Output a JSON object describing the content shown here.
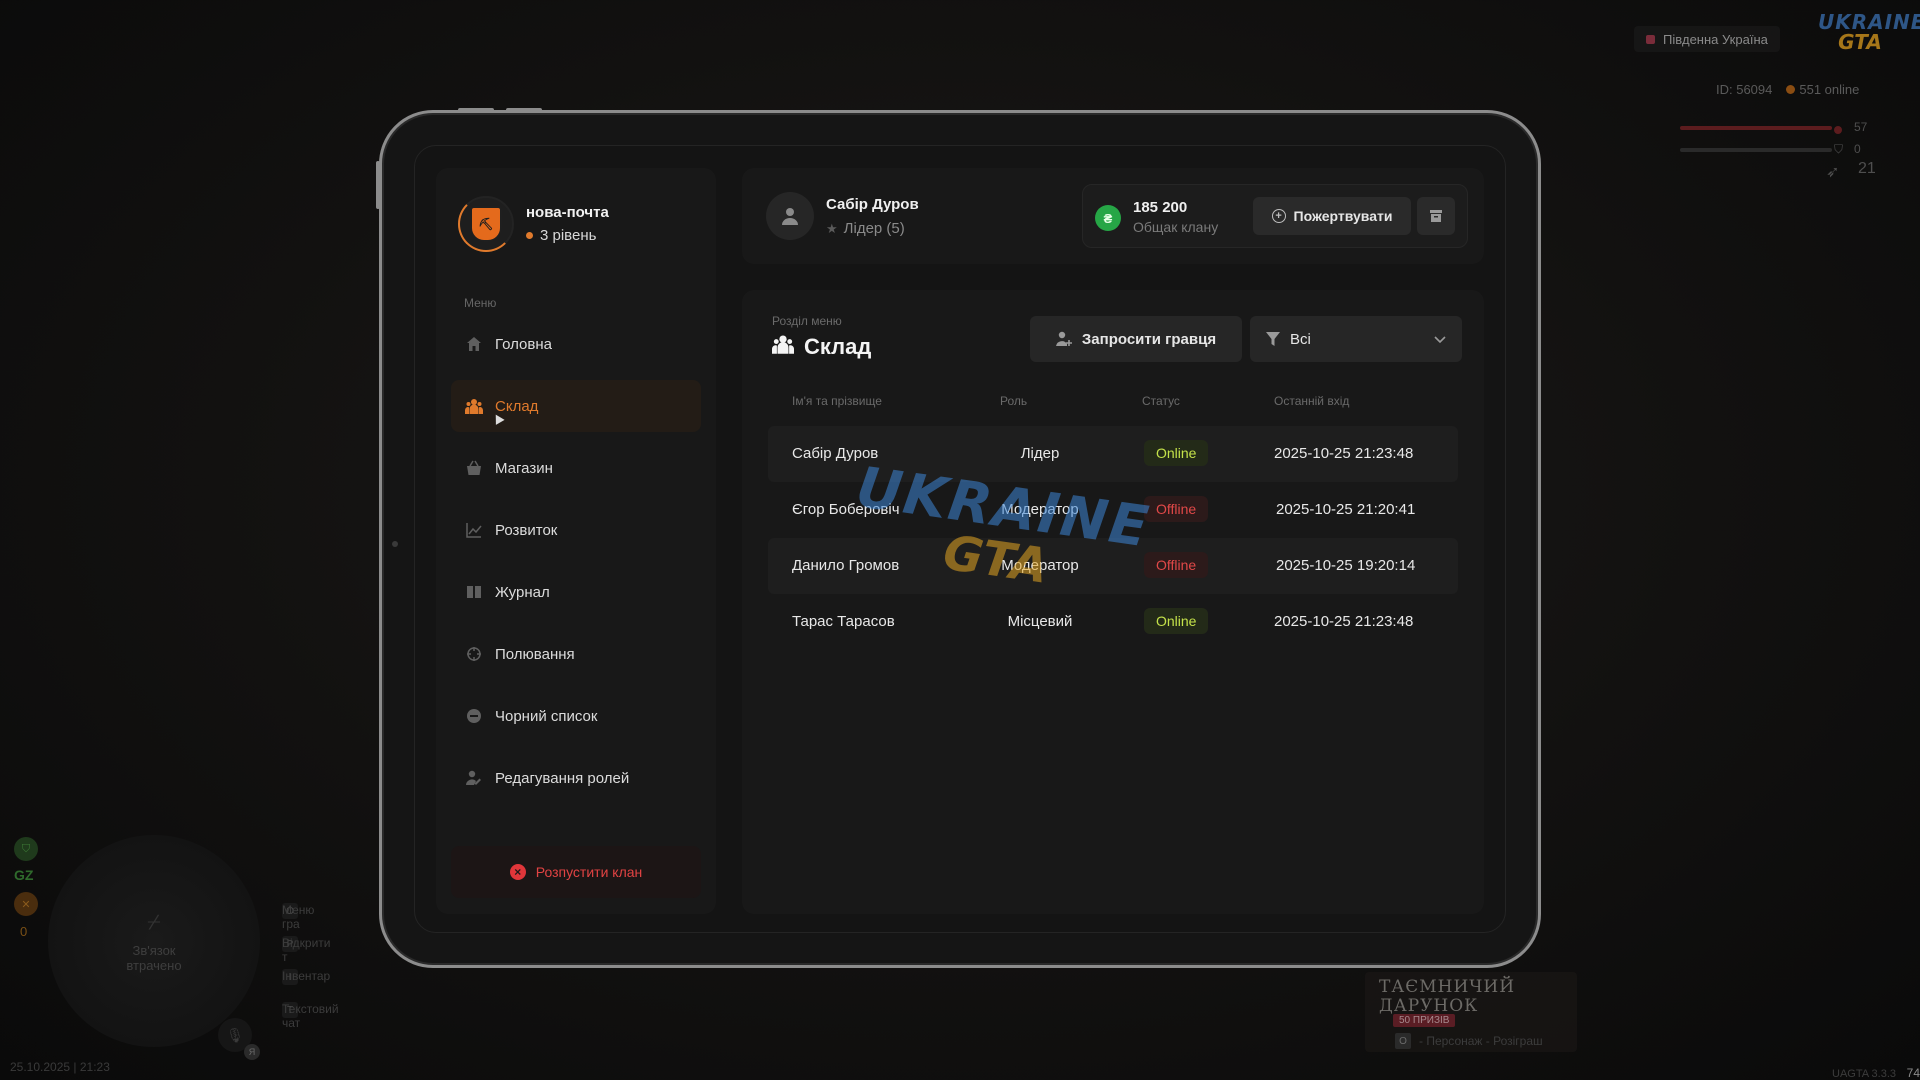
{
  "hud": {
    "server_name": "Південна Україна",
    "logo_line1": "UKRAINE",
    "logo_line2": "GTA",
    "player_id": "ID: 56094",
    "online": "551 online",
    "stat_health": "57",
    "stat_armor": "0",
    "stat_ammo": "21",
    "minimap_status": "Зв'язок втрачено",
    "gz_label": "GZ",
    "counter": "0",
    "keys": [
      {
        "key": "O",
        "label": "Меню гра"
      },
      {
        "key": "P",
        "label": "Відкрити т"
      },
      {
        "key": "I",
        "label": "Інвентар"
      },
      {
        "key": "T",
        "label": "Текстовий чат"
      }
    ],
    "mic_key": "Я",
    "datetime": "25.10.2025 | 21:23",
    "version": "UAGTA 3.3.3",
    "fps": "74",
    "promo_title_1": "ТАЄМНИЧИЙ",
    "promo_title_2": "ДАРУНОК",
    "promo_badge": "50 ПРИЗІВ",
    "promo_key": "O",
    "promo_footer": "- Персонаж - Розіграш"
  },
  "clan": {
    "name": "нова-почта",
    "level": "3 рівень"
  },
  "menu": {
    "label": "Меню",
    "items": [
      {
        "label": "Головна",
        "icon": "home-icon"
      },
      {
        "label": "Склад",
        "icon": "members-icon"
      },
      {
        "label": "Магазин",
        "icon": "basket-icon"
      },
      {
        "label": "Розвиток",
        "icon": "chart-icon"
      },
      {
        "label": "Журнал",
        "icon": "book-icon"
      },
      {
        "label": "Полювання",
        "icon": "crosshair-icon"
      },
      {
        "label": "Чорний список",
        "icon": "block-icon"
      },
      {
        "label": "Редагування ролей",
        "icon": "user-edit-icon"
      }
    ],
    "active_index": 1,
    "disband_label": "Розпустити клан"
  },
  "profile": {
    "name": "Сабір Дуров",
    "role": "Лідер (5)"
  },
  "bank": {
    "currency_symbol": "₴",
    "amount": "185 200",
    "label": "Общак клану",
    "donate_label": "Пожертвувати"
  },
  "section": {
    "label": "Розділ меню",
    "title": "Склад",
    "invite_label": "Запросити гравця",
    "filter_value": "Всі"
  },
  "table": {
    "headers": [
      "Ім'я та прізвище",
      "Роль",
      "Статус",
      "Останній вхід"
    ],
    "rows": [
      {
        "name": "Сабір Дуров",
        "role": "Лідер",
        "status": "Online",
        "last": "2025-10-25 21:23:48"
      },
      {
        "name": "Єгор Боберовіч",
        "role": "Модератор",
        "status": "Offline",
        "last": "2025-10-25 21:20:41"
      },
      {
        "name": "Данило Громов",
        "role": "Модератор",
        "status": "Offline",
        "last": "2025-10-25 19:20:14"
      },
      {
        "name": "Тарас Тарасов",
        "role": "Місцевий",
        "status": "Online",
        "last": "2025-10-25 21:23:48"
      }
    ]
  },
  "watermark": {
    "line1": "UKRAINE",
    "line2": "GTA"
  },
  "colors": {
    "accent": "#e07a2c",
    "online": "#c4e24a",
    "offline": "#e04848",
    "danger": "#e24343",
    "money": "#26a646"
  }
}
